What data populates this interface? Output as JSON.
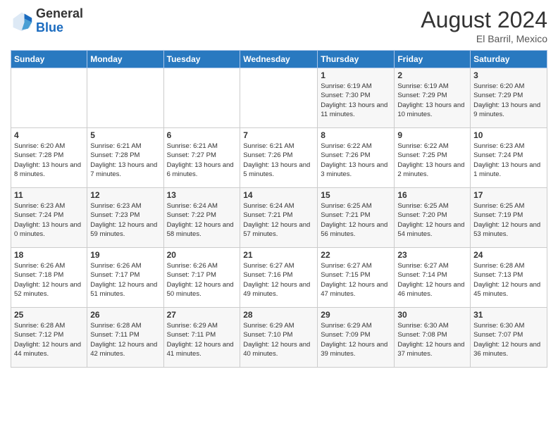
{
  "header": {
    "logo_line1": "General",
    "logo_line2": "Blue",
    "month_title": "August 2024",
    "subtitle": "El Barril, Mexico"
  },
  "days_of_week": [
    "Sunday",
    "Monday",
    "Tuesday",
    "Wednesday",
    "Thursday",
    "Friday",
    "Saturday"
  ],
  "weeks": [
    [
      {
        "day": "",
        "info": ""
      },
      {
        "day": "",
        "info": ""
      },
      {
        "day": "",
        "info": ""
      },
      {
        "day": "",
        "info": ""
      },
      {
        "day": "1",
        "info": "Sunrise: 6:19 AM\nSunset: 7:30 PM\nDaylight: 13 hours and 11 minutes."
      },
      {
        "day": "2",
        "info": "Sunrise: 6:19 AM\nSunset: 7:29 PM\nDaylight: 13 hours and 10 minutes."
      },
      {
        "day": "3",
        "info": "Sunrise: 6:20 AM\nSunset: 7:29 PM\nDaylight: 13 hours and 9 minutes."
      }
    ],
    [
      {
        "day": "4",
        "info": "Sunrise: 6:20 AM\nSunset: 7:28 PM\nDaylight: 13 hours and 8 minutes."
      },
      {
        "day": "5",
        "info": "Sunrise: 6:21 AM\nSunset: 7:28 PM\nDaylight: 13 hours and 7 minutes."
      },
      {
        "day": "6",
        "info": "Sunrise: 6:21 AM\nSunset: 7:27 PM\nDaylight: 13 hours and 6 minutes."
      },
      {
        "day": "7",
        "info": "Sunrise: 6:21 AM\nSunset: 7:26 PM\nDaylight: 13 hours and 5 minutes."
      },
      {
        "day": "8",
        "info": "Sunrise: 6:22 AM\nSunset: 7:26 PM\nDaylight: 13 hours and 3 minutes."
      },
      {
        "day": "9",
        "info": "Sunrise: 6:22 AM\nSunset: 7:25 PM\nDaylight: 13 hours and 2 minutes."
      },
      {
        "day": "10",
        "info": "Sunrise: 6:23 AM\nSunset: 7:24 PM\nDaylight: 13 hours and 1 minute."
      }
    ],
    [
      {
        "day": "11",
        "info": "Sunrise: 6:23 AM\nSunset: 7:24 PM\nDaylight: 13 hours and 0 minutes."
      },
      {
        "day": "12",
        "info": "Sunrise: 6:23 AM\nSunset: 7:23 PM\nDaylight: 12 hours and 59 minutes."
      },
      {
        "day": "13",
        "info": "Sunrise: 6:24 AM\nSunset: 7:22 PM\nDaylight: 12 hours and 58 minutes."
      },
      {
        "day": "14",
        "info": "Sunrise: 6:24 AM\nSunset: 7:21 PM\nDaylight: 12 hours and 57 minutes."
      },
      {
        "day": "15",
        "info": "Sunrise: 6:25 AM\nSunset: 7:21 PM\nDaylight: 12 hours and 56 minutes."
      },
      {
        "day": "16",
        "info": "Sunrise: 6:25 AM\nSunset: 7:20 PM\nDaylight: 12 hours and 54 minutes."
      },
      {
        "day": "17",
        "info": "Sunrise: 6:25 AM\nSunset: 7:19 PM\nDaylight: 12 hours and 53 minutes."
      }
    ],
    [
      {
        "day": "18",
        "info": "Sunrise: 6:26 AM\nSunset: 7:18 PM\nDaylight: 12 hours and 52 minutes."
      },
      {
        "day": "19",
        "info": "Sunrise: 6:26 AM\nSunset: 7:17 PM\nDaylight: 12 hours and 51 minutes."
      },
      {
        "day": "20",
        "info": "Sunrise: 6:26 AM\nSunset: 7:17 PM\nDaylight: 12 hours and 50 minutes."
      },
      {
        "day": "21",
        "info": "Sunrise: 6:27 AM\nSunset: 7:16 PM\nDaylight: 12 hours and 49 minutes."
      },
      {
        "day": "22",
        "info": "Sunrise: 6:27 AM\nSunset: 7:15 PM\nDaylight: 12 hours and 47 minutes."
      },
      {
        "day": "23",
        "info": "Sunrise: 6:27 AM\nSunset: 7:14 PM\nDaylight: 12 hours and 46 minutes."
      },
      {
        "day": "24",
        "info": "Sunrise: 6:28 AM\nSunset: 7:13 PM\nDaylight: 12 hours and 45 minutes."
      }
    ],
    [
      {
        "day": "25",
        "info": "Sunrise: 6:28 AM\nSunset: 7:12 PM\nDaylight: 12 hours and 44 minutes."
      },
      {
        "day": "26",
        "info": "Sunrise: 6:28 AM\nSunset: 7:11 PM\nDaylight: 12 hours and 42 minutes."
      },
      {
        "day": "27",
        "info": "Sunrise: 6:29 AM\nSunset: 7:11 PM\nDaylight: 12 hours and 41 minutes."
      },
      {
        "day": "28",
        "info": "Sunrise: 6:29 AM\nSunset: 7:10 PM\nDaylight: 12 hours and 40 minutes."
      },
      {
        "day": "29",
        "info": "Sunrise: 6:29 AM\nSunset: 7:09 PM\nDaylight: 12 hours and 39 minutes."
      },
      {
        "day": "30",
        "info": "Sunrise: 6:30 AM\nSunset: 7:08 PM\nDaylight: 12 hours and 37 minutes."
      },
      {
        "day": "31",
        "info": "Sunrise: 6:30 AM\nSunset: 7:07 PM\nDaylight: 12 hours and 36 minutes."
      }
    ]
  ]
}
